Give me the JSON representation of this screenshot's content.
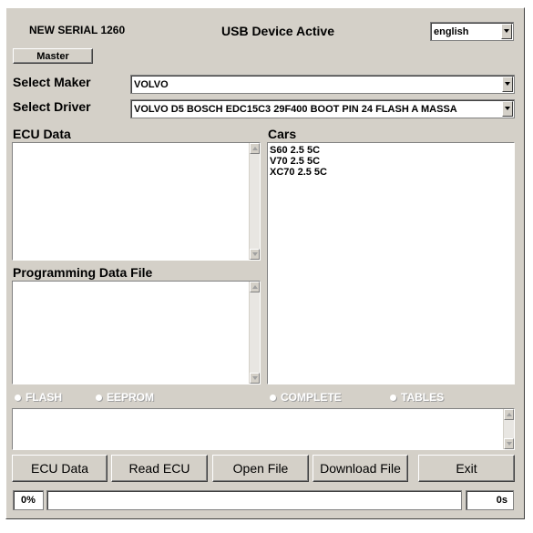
{
  "header": {
    "serial": "NEW SERIAL 1260",
    "usb_status": "USB Device Active",
    "language": "english",
    "master_label": "Master"
  },
  "maker": {
    "label": "Select Maker",
    "value": "VOLVO"
  },
  "driver": {
    "label": "Select Driver",
    "value": "VOLVO D5 BOSCH EDC15C3 29F400 BOOT PIN 24 FLASH A MASSA"
  },
  "ecu_data": {
    "label": "ECU Data"
  },
  "cars": {
    "label": "Cars",
    "items": [
      "S60 2.5 5C",
      "V70 2.5 5C",
      "XC70 2.5 5C"
    ]
  },
  "programming": {
    "label": "Programming Data File"
  },
  "radios": {
    "flash": "FLASH",
    "eeprom": "EEPROM",
    "complete": "COMPLETE",
    "tables": "TABLES"
  },
  "buttons": {
    "ecu_data": "ECU Data",
    "read_ecu": "Read ECU",
    "open_file": "Open File",
    "download_file": "Download File",
    "exit": "Exit"
  },
  "status": {
    "percent": "0%",
    "progress": 0,
    "time": "0s"
  }
}
